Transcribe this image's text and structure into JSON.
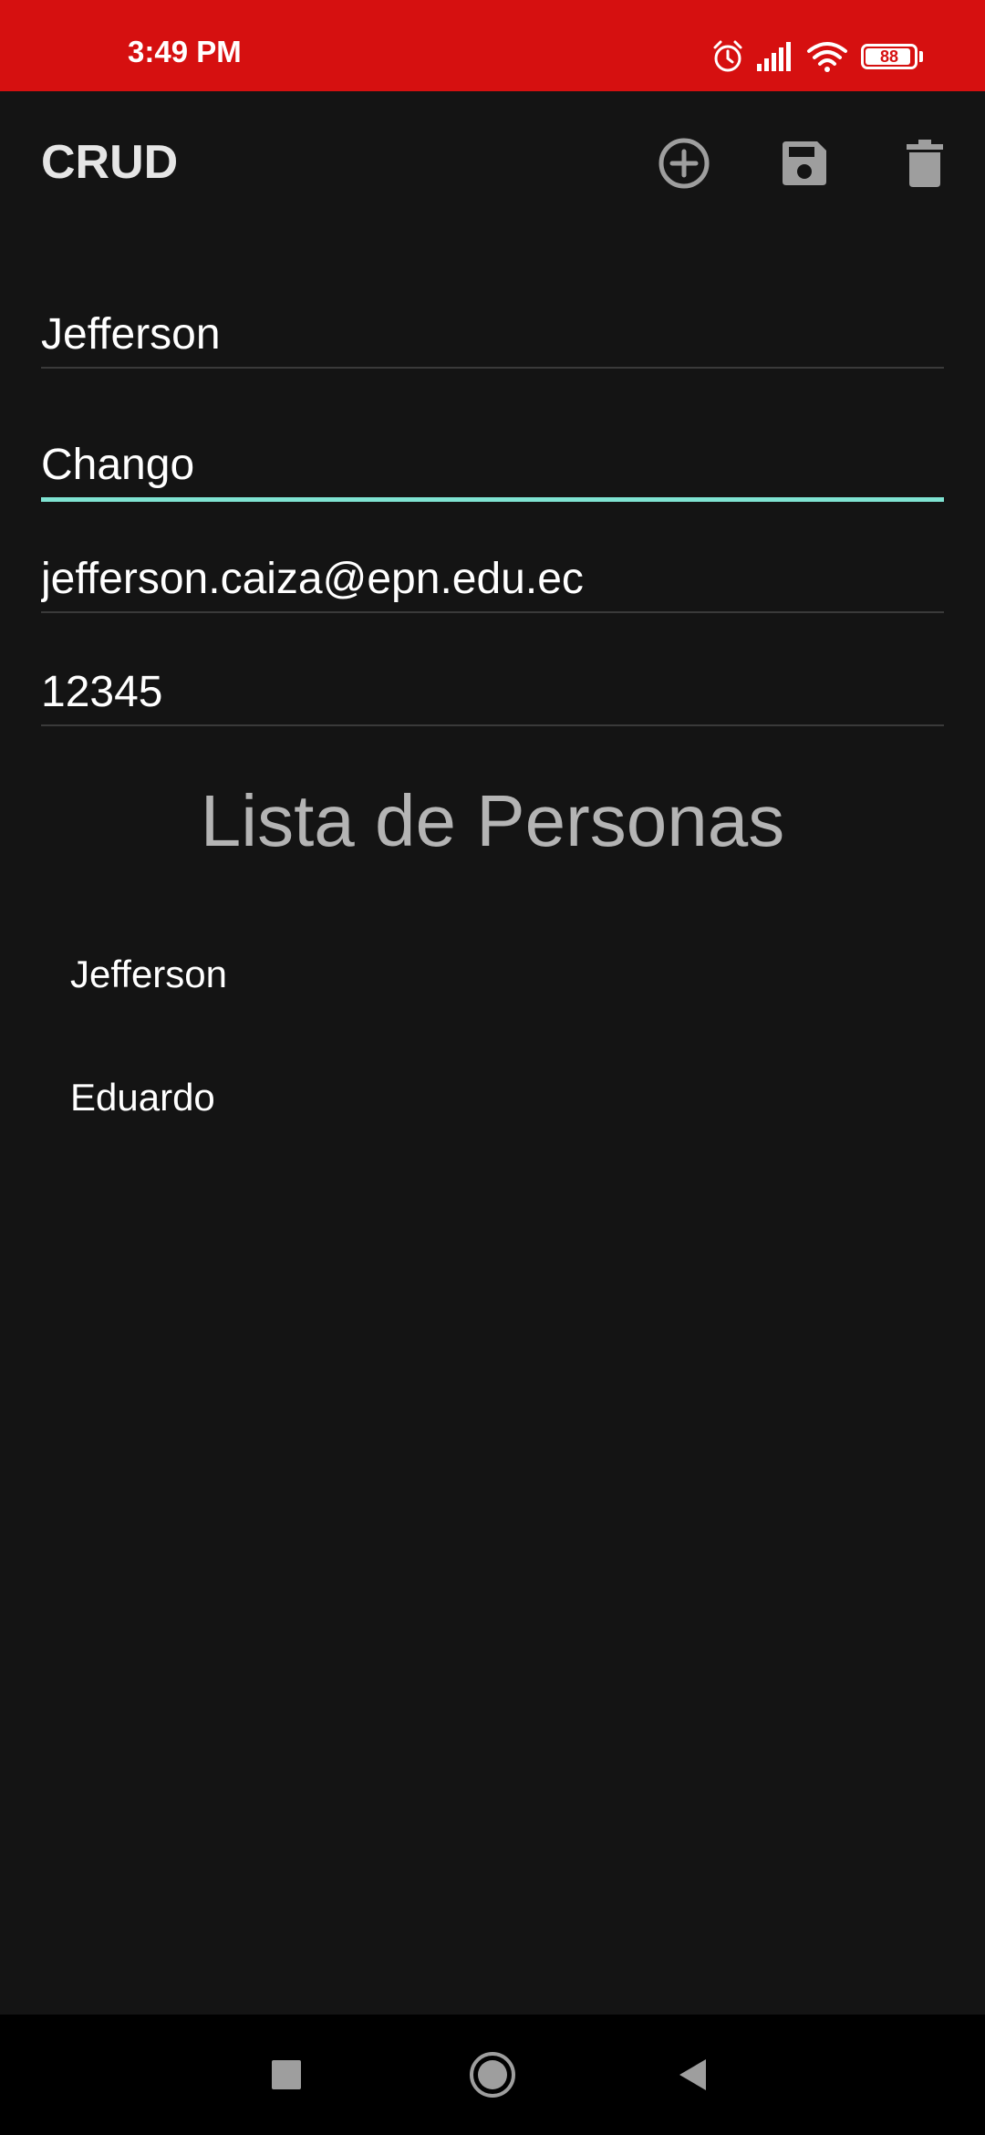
{
  "status_bar": {
    "time": "3:49 PM",
    "battery_level": "88",
    "icons": [
      "alarm-icon",
      "signal-icon",
      "wifi-icon",
      "battery-icon"
    ],
    "background_color": "#d61010"
  },
  "app_bar": {
    "title": "CRUD",
    "actions": [
      "add-circle-icon",
      "save-icon",
      "delete-icon"
    ]
  },
  "form": {
    "first_name": "Jefferson",
    "last_name": "Chango",
    "email": "jefferson.caiza@epn.edu.ec",
    "password": "12345",
    "focused_field": "last_name",
    "accent_color": "#7fe3d2"
  },
  "list": {
    "title": "Lista de Personas",
    "items": [
      "Jefferson",
      "Eduardo"
    ]
  },
  "nav_bar": {
    "buttons": [
      "recents-icon",
      "home-icon",
      "back-icon"
    ]
  }
}
